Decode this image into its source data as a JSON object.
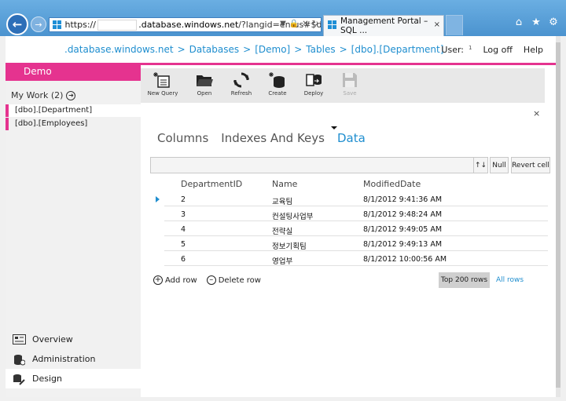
{
  "browser": {
    "address": {
      "scheme": "https://",
      "host_suffix": ".database.windows.net",
      "path": "/?langid=en-us#$da"
    },
    "tab_title": "Management Portal – SQL ...",
    "tab_close": "×"
  },
  "topbar": {
    "breadcrumb": [
      ".database.windows.net",
      "Databases",
      "[Demo]",
      "Tables",
      "[dbo].[Department]"
    ],
    "breadcrumb_sep": ">",
    "user_label": "User:",
    "user_name": "1",
    "logoff": "Log off",
    "help": "Help"
  },
  "sidebar": {
    "db_name": "Demo",
    "my_work": "My Work (2)",
    "work_items": [
      "[dbo].[Department]",
      "[dbo].[Employees]"
    ],
    "nav": [
      {
        "label": "Overview",
        "icon": "overview-icon"
      },
      {
        "label": "Administration",
        "icon": "administration-icon"
      },
      {
        "label": "Design",
        "icon": "design-icon"
      }
    ]
  },
  "toolbar": {
    "new_query": "New Query",
    "open": "Open",
    "refresh": "Refresh",
    "create": "Create",
    "deploy": "Deploy",
    "save": "Save"
  },
  "close": "×",
  "tabs": [
    "Columns",
    "Indexes And Keys",
    "Data"
  ],
  "editor": {
    "sort_label": "↑↓",
    "null_label": "Null",
    "revert_label": "Revert cell"
  },
  "grid": {
    "columns": [
      "DepartmentID",
      "Name",
      "ModifiedDate"
    ],
    "rows": [
      [
        "2",
        "교육팀",
        "8/1/2012 9:41:36 AM"
      ],
      [
        "3",
        "컨설팅사업부",
        "8/1/2012 9:48:24 AM"
      ],
      [
        "4",
        "전략실",
        "8/1/2012 9:49:05 AM"
      ],
      [
        "5",
        "정보기획팀",
        "8/1/2012 9:49:13 AM"
      ],
      [
        "6",
        "영업부",
        "8/1/2012 10:00:56 AM"
      ]
    ]
  },
  "actions": {
    "add_row": "Add row",
    "delete_row": "Delete row",
    "top_rows": "Top 200 rows",
    "all_rows": "All rows"
  },
  "colors": {
    "accent": "#1f8ecf",
    "brand_pink": "#e5338f"
  }
}
